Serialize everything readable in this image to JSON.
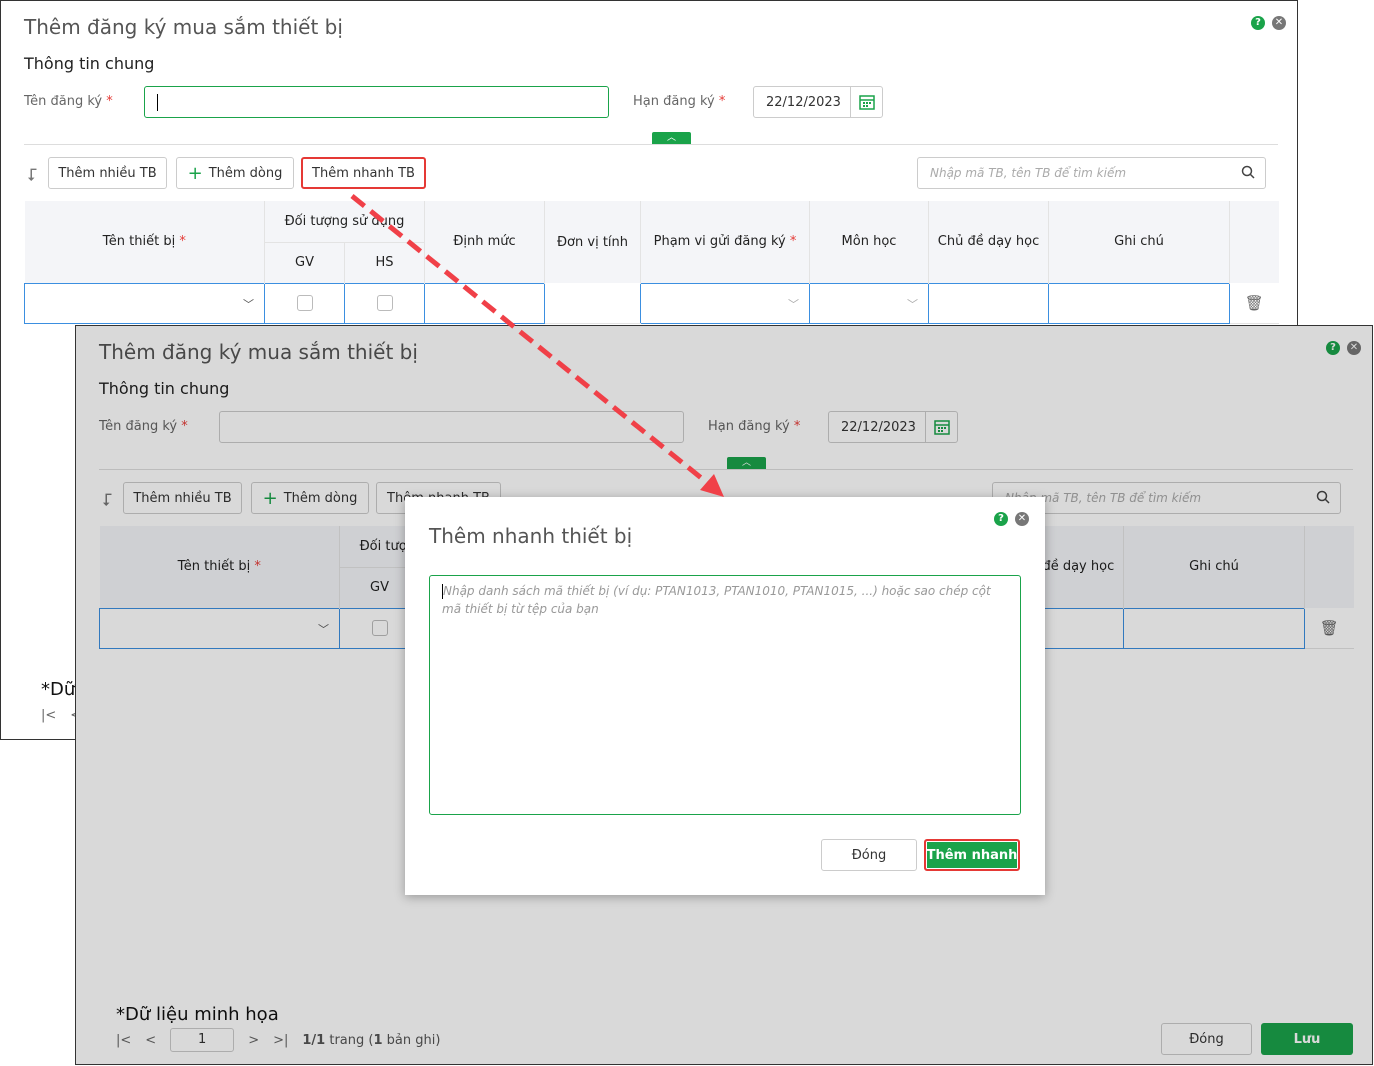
{
  "window": {
    "title": "Thêm đăng ký mua sắm thiết bị",
    "section": "Thông tin chung",
    "name_label": "Tên đăng ký",
    "deadline_label": "Hạn đăng ký",
    "required_mark": "*",
    "deadline_value": "22/12/2023",
    "toolbar": {
      "add_many": "Thêm nhiều TB",
      "add_row": "Thêm dòng",
      "quick_add": "Thêm nhanh TB",
      "search_placeholder": "Nhập mã TB, tên TB để tìm kiếm"
    },
    "table": {
      "columns": {
        "device": "Tên thiết bị",
        "target": "Đối tượng sử dụng",
        "gv": "GV",
        "hs": "HS",
        "norm": "Định mức",
        "unit": "Đơn vị tính",
        "scope": "Phạm vi gửi đăng ký",
        "subject": "Môn học",
        "topic": "Chủ đề dạy học",
        "note": "Ghi chú"
      }
    },
    "note": "*Dữ liệu minh họa",
    "pager": {
      "page": "1",
      "pages": "1/1",
      "trang": "trang (",
      "count": "1",
      "records": "bản ghi)"
    },
    "close_button": "Đóng",
    "save_button": "Lưu"
  },
  "modal": {
    "title": "Thêm nhanh thiết bị",
    "placeholder": "Nhập danh sách mã thiết bị (ví dụ: PTAN1013, PTAN1010, PTAN1015, ...) hoặc sao chép cột mã thiết bị từ tệp của bạn",
    "close_button": "Đóng",
    "submit_button": "Thêm nhanh"
  },
  "colors": {
    "accent": "#1aa34a",
    "highlight": "#e53935"
  }
}
